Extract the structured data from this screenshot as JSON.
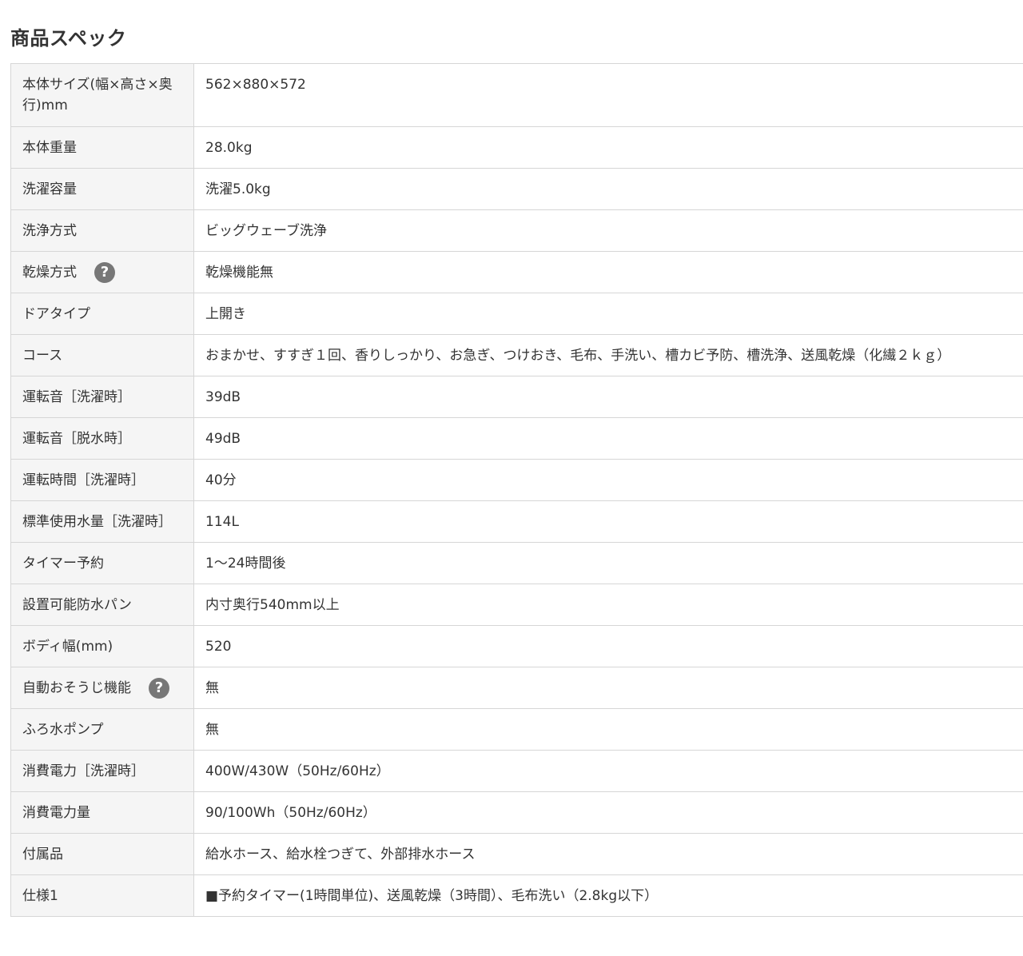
{
  "title": "商品スペック",
  "specs": [
    {
      "label": "本体サイズ(幅×高さ×奥行)mm",
      "value": "562×880×572"
    },
    {
      "label": "本体重量",
      "value": "28.0kg"
    },
    {
      "label": "洗濯容量",
      "value": "洗濯5.0kg"
    },
    {
      "label": "洗浄方式",
      "value": "ビッグウェーブ洗浄"
    },
    {
      "label": "乾燥方式",
      "value": "乾燥機能無",
      "help_icon": "?"
    },
    {
      "label": "ドアタイプ",
      "value": "上開き"
    },
    {
      "label": "コース",
      "value": "おまかせ、すすぎ１回、香りしっかり、お急ぎ、つけおき、毛布、手洗い、槽カビ予防、槽洗浄、送風乾燥（化繊２ｋｇ）"
    },
    {
      "label": "運転音［洗濯時］",
      "value": "39dB"
    },
    {
      "label": "運転音［脱水時］",
      "value": "49dB"
    },
    {
      "label": "運転時間［洗濯時］",
      "value": "40分"
    },
    {
      "label": "標準使用水量［洗濯時］",
      "value": "114L"
    },
    {
      "label": "タイマー予約",
      "value": "1～24時間後"
    },
    {
      "label": "設置可能防水パン",
      "value": "内寸奥行540mm以上"
    },
    {
      "label": "ボディ幅(mm)",
      "value": "520"
    },
    {
      "label": "自動おそうじ機能",
      "value": "無",
      "help_icon": "?"
    },
    {
      "label": "ふろ水ポンプ",
      "value": "無"
    },
    {
      "label": "消費電力［洗濯時］",
      "value": "400W/430W（50Hz/60Hz）"
    },
    {
      "label": "消費電力量",
      "value": "90/100Wh（50Hz/60Hz）"
    },
    {
      "label": "付属品",
      "value": "給水ホース、給水栓つぎて、外部排水ホース"
    },
    {
      "label": "仕様1",
      "value": "■予約タイマー(1時間単位)、送風乾燥（3時間）、毛布洗い（2.8kg以下）"
    }
  ]
}
